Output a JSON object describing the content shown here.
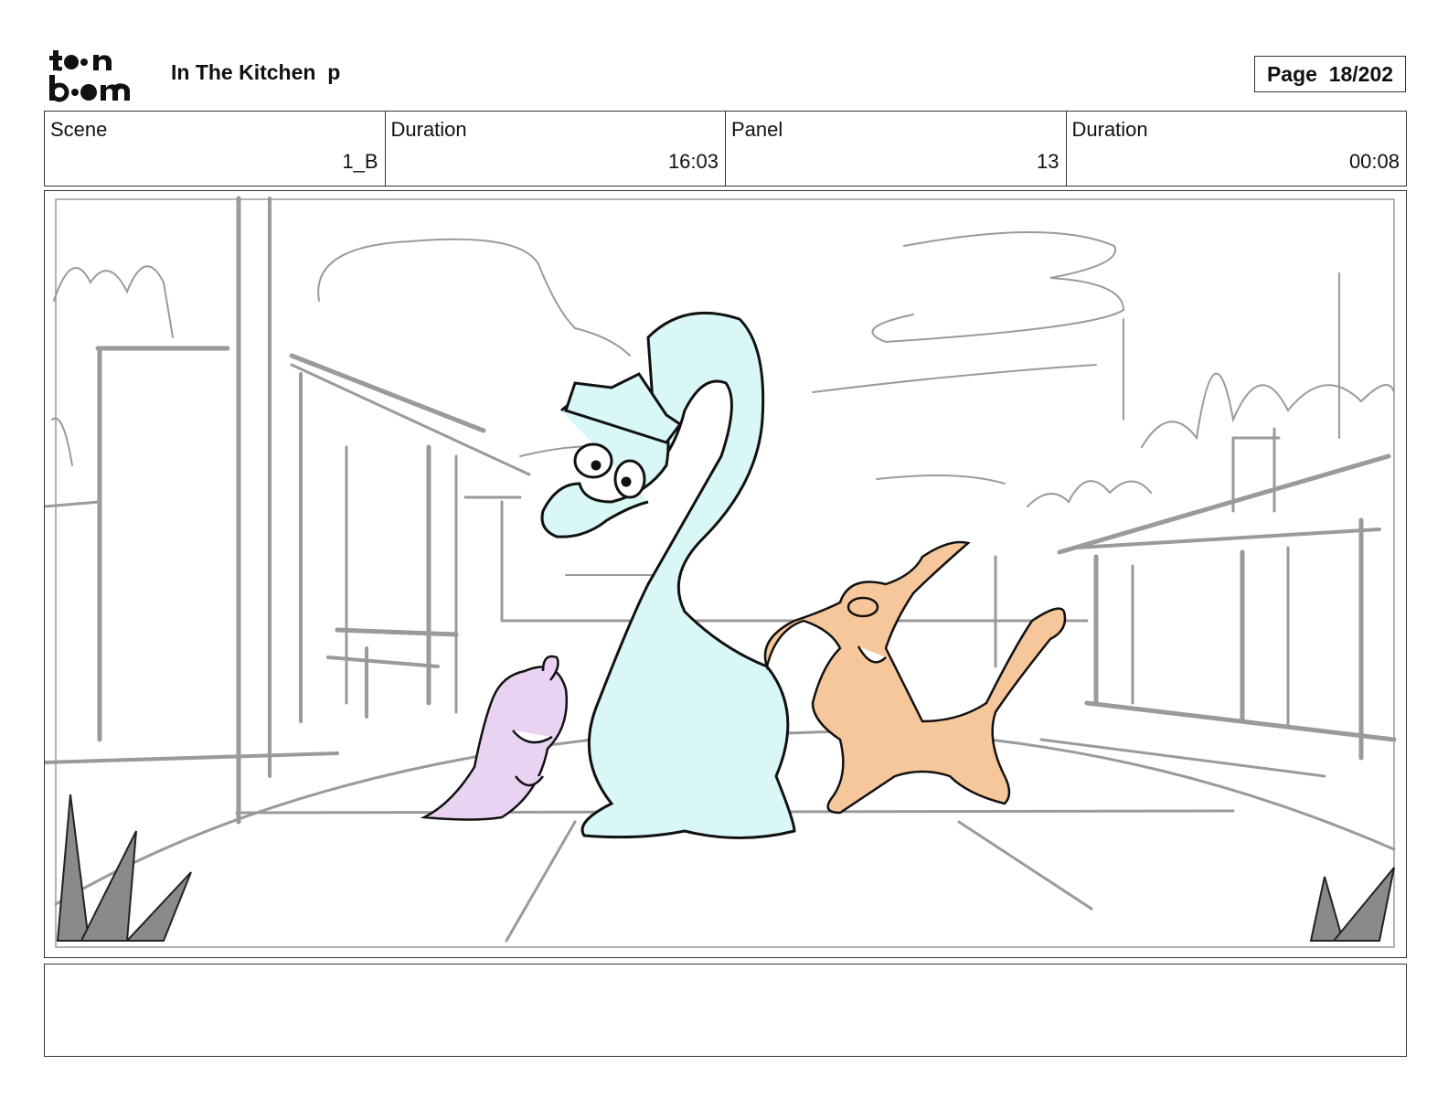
{
  "logo": {
    "line1": "toon",
    "line2": "boom",
    "icon": "toon-boom-logo"
  },
  "project_title": "In The Kitchen  p",
  "page_label": "Page  18/202",
  "info": [
    {
      "label": "Scene",
      "value": "1_B"
    },
    {
      "label": "Duration",
      "value": "16:03"
    },
    {
      "label": "Panel",
      "value": "13"
    },
    {
      "label": "Duration",
      "value": "00:08"
    }
  ],
  "notes": "",
  "colors": {
    "sketch_gray": "#9a9a9a",
    "dino_blue": "#d9f7f7",
    "pterodactyl_orange": "#f6c79a",
    "small_dino_purple": "#ead3f2",
    "ink": "#111111"
  }
}
